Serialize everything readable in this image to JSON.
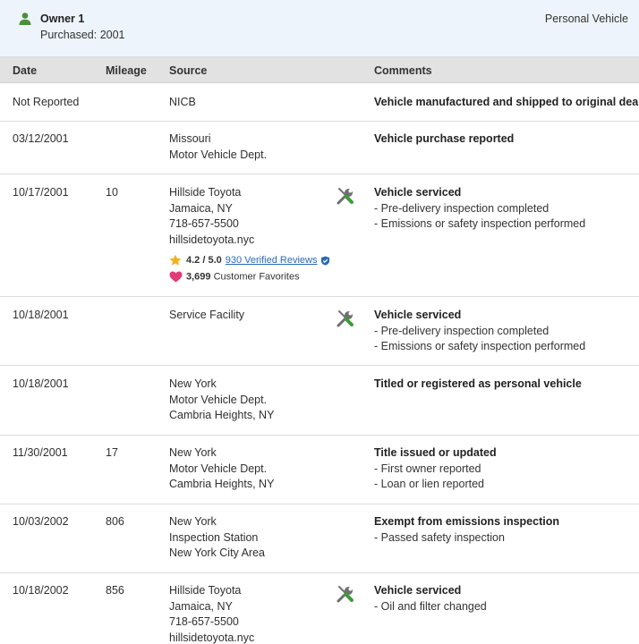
{
  "owner": {
    "name": "Owner 1",
    "purchased": "Purchased: 2001",
    "type": "Personal Vehicle",
    "icon": "person-icon",
    "icon_color": "#4a8f3c"
  },
  "columns": {
    "date": "Date",
    "mileage": "Mileage",
    "source": "Source",
    "comments": "Comments"
  },
  "records": [
    {
      "date": "Not Reported",
      "mileage": "",
      "source": [
        "NICB"
      ],
      "comment_title": "Vehicle manufactured and shipped to original dealer",
      "comment_items": []
    },
    {
      "date": "03/12/2001",
      "mileage": "",
      "source": [
        "Missouri",
        "Motor Vehicle Dept."
      ],
      "comment_title": "Vehicle purchase reported",
      "comment_items": []
    },
    {
      "date": "10/17/2001",
      "mileage": "10",
      "source": [
        "Hillside Toyota",
        "Jamaica, NY",
        "718-657-5500",
        "hillsidetoyota.nyc"
      ],
      "service_icon": "wrench-screwdriver-icon",
      "rating": {
        "score": "4.2 / 5.0",
        "reviews": "930 Verified Reviews",
        "favorites_count": "3,699",
        "favorites_label": "Customer Favorites"
      },
      "comment_title": "Vehicle serviced",
      "comment_items": [
        "- Pre-delivery inspection completed",
        "- Emissions or safety inspection performed"
      ]
    },
    {
      "date": "10/18/2001",
      "mileage": "",
      "source": [
        "Service Facility"
      ],
      "service_icon": "wrench-screwdriver-icon",
      "comment_title": "Vehicle serviced",
      "comment_items": [
        "- Pre-delivery inspection completed",
        "- Emissions or safety inspection performed"
      ]
    },
    {
      "date": "10/18/2001",
      "mileage": "",
      "source": [
        "New York",
        "Motor Vehicle Dept.",
        "Cambria Heights, NY"
      ],
      "comment_title": "Titled or registered as personal vehicle",
      "comment_items": []
    },
    {
      "date": "11/30/2001",
      "mileage": "17",
      "source": [
        "New York",
        "Motor Vehicle Dept.",
        "Cambria Heights, NY"
      ],
      "comment_title": "Title issued or updated",
      "comment_items": [
        "- First owner reported",
        "- Loan or lien reported"
      ]
    },
    {
      "date": "10/03/2002",
      "mileage": "806",
      "source": [
        "New York",
        "Inspection Station",
        "New York City Area"
      ],
      "comment_title": "Exempt from emissions inspection",
      "comment_items": [
        "- Passed safety inspection"
      ]
    },
    {
      "date": "10/18/2002",
      "mileage": "856",
      "source": [
        "Hillside Toyota",
        "Jamaica, NY",
        "718-657-5500",
        "hillsidetoyota.nyc"
      ],
      "service_icon": "wrench-screwdriver-icon",
      "comment_title": "Vehicle serviced",
      "comment_items": [
        "- Oil and filter changed"
      ]
    }
  ],
  "colors": {
    "header_bg": "#eef4fb",
    "column_header_bg": "#e2e2e2",
    "link": "#2a6ab3",
    "star": "#f2b01e",
    "heart": "#e23b77",
    "verified": "#2a6ab3",
    "wrench_green": "#3f9a3a",
    "wrench_gray": "#6f6f6f"
  }
}
